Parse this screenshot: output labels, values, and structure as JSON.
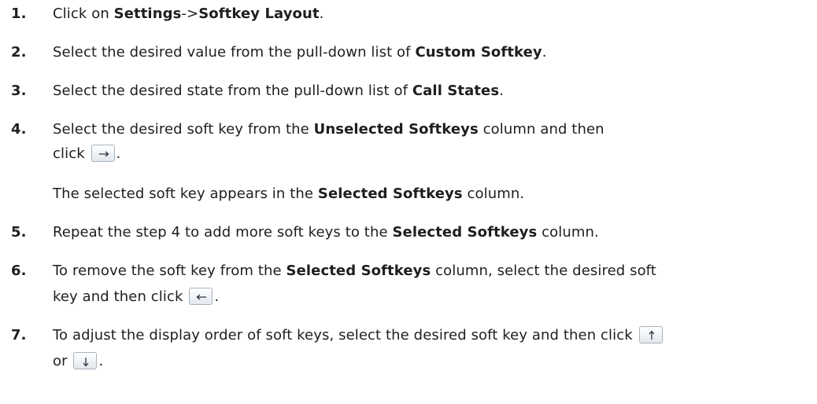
{
  "steps": [
    {
      "number": "1.",
      "lines": [
        [
          {
            "t": "Click on "
          },
          {
            "b": "Settings"
          },
          {
            "t": "->"
          },
          {
            "b": "Softkey Layout"
          },
          {
            "t": "."
          }
        ]
      ]
    },
    {
      "number": "2.",
      "lines": [
        [
          {
            "t": "Select the desired value from the pull-down list of "
          },
          {
            "b": "Custom Softkey"
          },
          {
            "t": "."
          }
        ]
      ]
    },
    {
      "number": "3.",
      "lines": [
        [
          {
            "t": "Select the desired state from the pull-down list of "
          },
          {
            "b": "Call States"
          },
          {
            "t": "."
          }
        ]
      ]
    },
    {
      "number": "4.",
      "lines": [
        [
          {
            "t": "Select the desired soft key from the "
          },
          {
            "b": "Unselected Softkeys"
          },
          {
            "t": " column and then"
          }
        ],
        [
          {
            "t": "click "
          },
          {
            "icon": "arrow-right-icon"
          },
          {
            "t": "."
          }
        ],
        [
          {
            "t": "The selected soft key appears in the "
          },
          {
            "b": "Selected Softkeys"
          },
          {
            "t": " column."
          }
        ]
      ]
    },
    {
      "number": "5.",
      "lines": [
        [
          {
            "t": "Repeat the step 4 to add more soft keys to the "
          },
          {
            "b": "Selected Softkeys"
          },
          {
            "t": " column."
          }
        ]
      ]
    },
    {
      "number": "6.",
      "lines": [
        [
          {
            "t": "To remove the soft key from the "
          },
          {
            "b": "Selected Softkeys"
          },
          {
            "t": " column, select the desired soft"
          }
        ],
        [
          {
            "t": "key and then click "
          },
          {
            "icon": "arrow-left-icon"
          },
          {
            "t": "."
          }
        ]
      ]
    },
    {
      "number": "7.",
      "lines": [
        [
          {
            "t": "To adjust the display order of soft keys, select the desired soft key and then click "
          },
          {
            "icon": "arrow-up-icon"
          }
        ],
        [
          {
            "t": "or "
          },
          {
            "icon": "arrow-down-icon"
          },
          {
            "t": "."
          }
        ]
      ]
    }
  ]
}
